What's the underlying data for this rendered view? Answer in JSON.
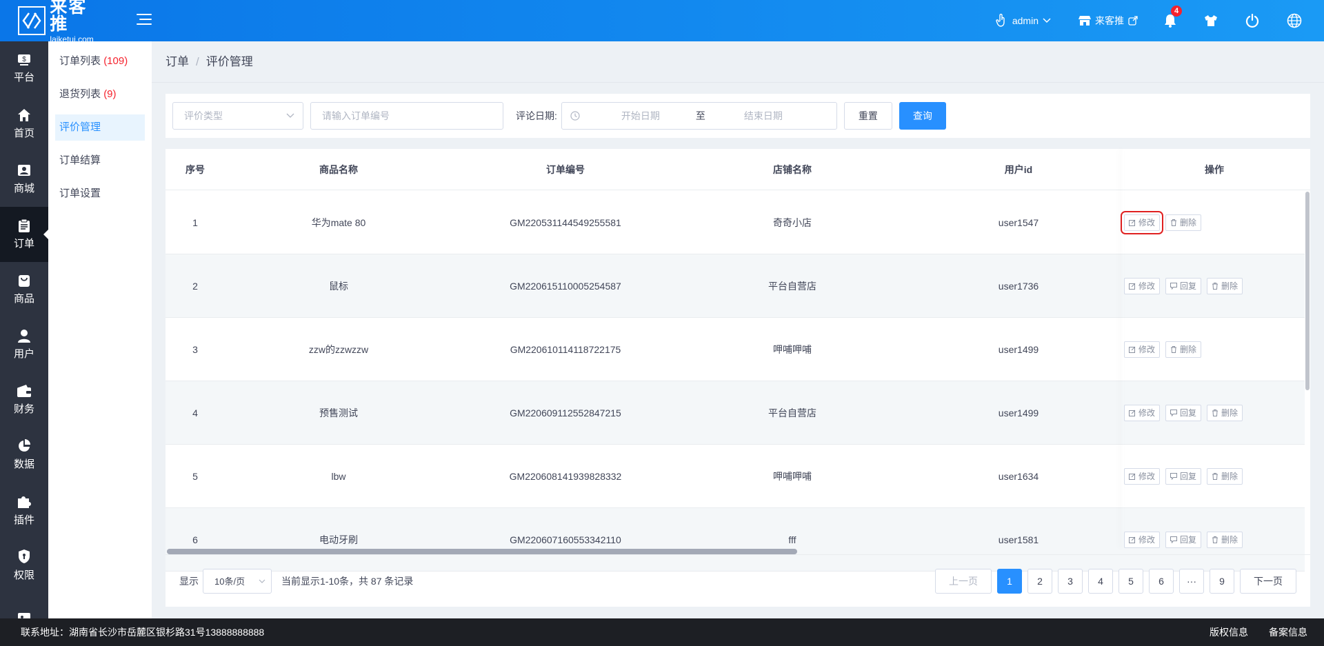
{
  "logo": {
    "name": "来客推",
    "domain": "laiketui.com"
  },
  "topbar": {
    "user": "admin",
    "store": "来客推",
    "notif_count": "4"
  },
  "sidebar": [
    {
      "label": "平台",
      "icon": "dollar-icon"
    },
    {
      "label": "首页",
      "icon": "home-icon"
    },
    {
      "label": "商城",
      "icon": "store-icon"
    },
    {
      "label": "订单",
      "icon": "clipboard-icon",
      "active": true
    },
    {
      "label": "商品",
      "icon": "bag-icon"
    },
    {
      "label": "用户",
      "icon": "user-icon"
    },
    {
      "label": "财务",
      "icon": "wallet-icon"
    },
    {
      "label": "数据",
      "icon": "pie-chart-icon"
    },
    {
      "label": "插件",
      "icon": "puzzle-icon"
    },
    {
      "label": "权限",
      "icon": "shield-icon"
    },
    {
      "label": "",
      "icon": "image-icon"
    }
  ],
  "subnav": [
    {
      "label": "订单列表",
      "count": "(109)"
    },
    {
      "label": "退货列表",
      "count": "(9)"
    },
    {
      "label": "评价管理",
      "count": "",
      "active": true
    },
    {
      "label": "订单结算",
      "count": ""
    },
    {
      "label": "订单设置",
      "count": ""
    }
  ],
  "breadcrumb": {
    "parent": "订单",
    "sep": "/",
    "current": "评价管理"
  },
  "filter": {
    "type_placeholder": "评价类型",
    "order_placeholder": "请输入订单编号",
    "date_label": "评论日期:",
    "start_placeholder": "开始日期",
    "to": "至",
    "end_placeholder": "结束日期",
    "reset": "重置",
    "search": "查询"
  },
  "table": {
    "headers": [
      "序号",
      "商品名称",
      "订单编号",
      "店铺名称",
      "用户id",
      "操作"
    ],
    "rows": [
      {
        "no": "1",
        "product": "华为mate 80",
        "order": "GM220531144549255581",
        "shop": "奇奇小店",
        "user": "user1547",
        "reply": false
      },
      {
        "no": "2",
        "product": "鼠标",
        "order": "GM220615110005254587",
        "shop": "平台自营店",
        "user": "user1736",
        "reply": true
      },
      {
        "no": "3",
        "product": "zzw的zzwzzw",
        "order": "GM220610114118722175",
        "shop": "呷哺呷哺",
        "user": "user1499",
        "reply": false
      },
      {
        "no": "4",
        "product": "预售测试",
        "order": "GM220609112552847215",
        "shop": "平台自营店",
        "user": "user1499",
        "reply": true
      },
      {
        "no": "5",
        "product": "lbw",
        "order": "GM220608141939828332",
        "shop": "呷哺呷哺",
        "user": "user1634",
        "reply": true
      },
      {
        "no": "6",
        "product": "电动牙刷",
        "order": "GM220607160553342110",
        "shop": "fff",
        "user": "user1581",
        "reply": true
      }
    ],
    "actions": {
      "edit": "修改",
      "reply": "回复",
      "delete": "删除"
    }
  },
  "pagination": {
    "show": "显示",
    "page_size": "10条/页",
    "summary": "当前显示1-10条，共 87 条记录",
    "prev": "上一页",
    "pages": [
      "1",
      "2",
      "3",
      "4",
      "5",
      "6",
      "···",
      "9"
    ],
    "current": "1",
    "next": "下一页"
  },
  "footer": {
    "address": "联系地址：湖南省长沙市岳麓区银杉路31号13888888888",
    "copyright": "版权信息",
    "filing": "备案信息"
  }
}
